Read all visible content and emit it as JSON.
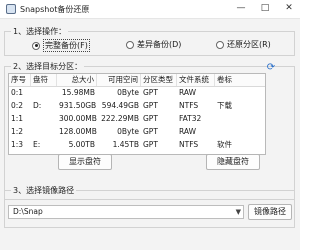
{
  "window": {
    "title": "Snapshot备份还原",
    "minimize_glyph": "—",
    "maximize_glyph": "□",
    "close_glyph": "✕"
  },
  "step1": {
    "legend": "1、选择操作：",
    "options": [
      {
        "label": "完整备份(F)",
        "checked": true
      },
      {
        "label": "差异备份(D)",
        "checked": false
      },
      {
        "label": "还原分区(R)",
        "checked": false
      }
    ]
  },
  "step2": {
    "legend": "2、选择目标分区：",
    "columns": [
      "序号",
      "盘符",
      "总大小",
      "可用空间",
      "分区类型",
      "文件系统",
      "卷标"
    ],
    "rows": [
      {
        "index": "0:1",
        "drive": "",
        "total": "15.98MB",
        "free": "0Byte",
        "part_type": "GPT",
        "fs": "RAW",
        "label": ""
      },
      {
        "index": "0:2",
        "drive": "D:",
        "total": "931.50GB",
        "free": "594.49GB",
        "part_type": "GPT",
        "fs": "NTFS",
        "label": "下载"
      },
      {
        "index": "1:1",
        "drive": "",
        "total": "300.00MB",
        "free": "222.29MB",
        "part_type": "GPT",
        "fs": "FAT32",
        "label": ""
      },
      {
        "index": "1:2",
        "drive": "",
        "total": "128.00MB",
        "free": "0Byte",
        "part_type": "GPT",
        "fs": "RAW",
        "label": ""
      },
      {
        "index": "1:3",
        "drive": "E:",
        "total": "5.00TB",
        "free": "1.45TB",
        "part_type": "GPT",
        "fs": "NTFS",
        "label": "软件"
      }
    ],
    "show_drive_button": "显示盘符",
    "hide_drive_button": "隐藏盘符",
    "refresh_icon": "refresh-icon"
  },
  "step3": {
    "legend": "3、选择镜像路径",
    "path_value": "D:\\Snap",
    "browse_button": "镜像路径"
  }
}
